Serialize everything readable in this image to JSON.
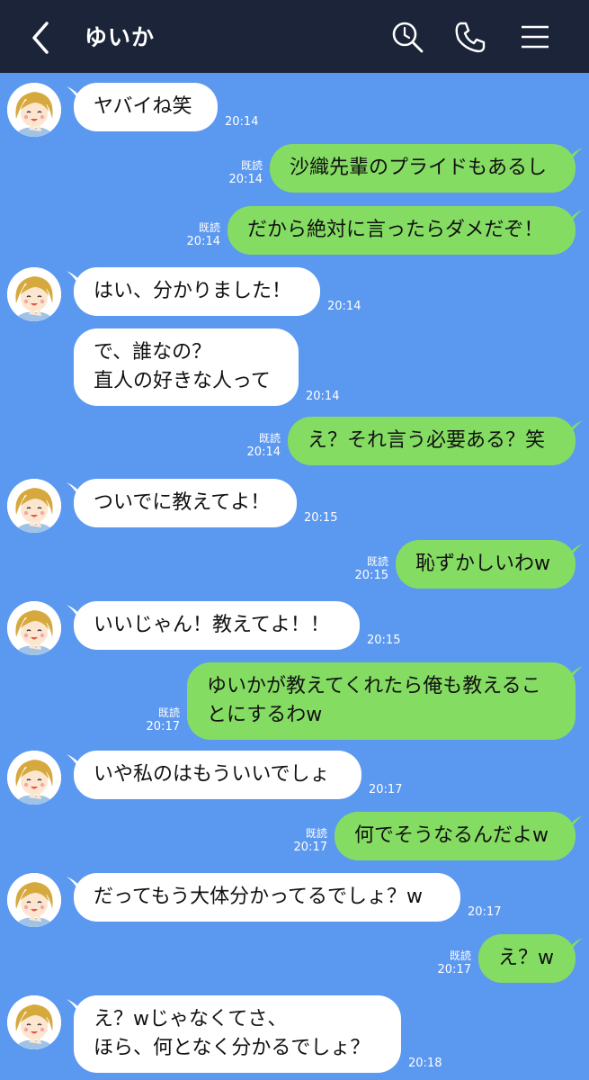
{
  "header": {
    "title": "ゆいか"
  },
  "read_label": "既読",
  "messages": [
    {
      "side": "in",
      "avatar": true,
      "text": "ヤバイね笑",
      "time": "20:14"
    },
    {
      "side": "out",
      "text": "沙織先輩のプライドもあるし",
      "time": "20:14"
    },
    {
      "side": "out",
      "text": "だから絶対に言ったらダメだぞ！",
      "time": "20:14"
    },
    {
      "side": "in",
      "avatar": true,
      "text": "はい、分かりました！",
      "time": "20:14"
    },
    {
      "side": "in",
      "avatar": false,
      "text": "で、誰なの？\n直人の好きな人って",
      "time": "20:14"
    },
    {
      "side": "out",
      "text": "え？それ言う必要ある？笑",
      "time": "20:14"
    },
    {
      "side": "in",
      "avatar": true,
      "text": "ついでに教えてよ！",
      "time": "20:15"
    },
    {
      "side": "out",
      "text": "恥ずかしいわw",
      "time": "20:15"
    },
    {
      "side": "in",
      "avatar": true,
      "text": "いいじゃん！教えてよ！！",
      "time": "20:15"
    },
    {
      "side": "out",
      "text": "ゆいかが教えてくれたら俺も教えるこ\nとにするわw",
      "time": "20:17"
    },
    {
      "side": "in",
      "avatar": true,
      "text": "いや私のはもういいでしょ",
      "time": "20:17"
    },
    {
      "side": "out",
      "text": "何でそうなるんだよw",
      "time": "20:17"
    },
    {
      "side": "in",
      "avatar": true,
      "text": "だってもう大体分かってるでしょ？w",
      "time": "20:17"
    },
    {
      "side": "out",
      "text": "え？w",
      "time": "20:17"
    },
    {
      "side": "in",
      "avatar": true,
      "text": "え？wじゃなくてさ、\nほら、何となく分かるでしょ？",
      "time": "20:18"
    }
  ],
  "colors": {
    "background": "#5b98f0",
    "header": "#1b2438",
    "bubble_out": "#85dc63",
    "bubble_in": "#ffffff"
  },
  "icons": [
    "back-arrow-icon",
    "search-icon",
    "phone-icon",
    "menu-icon",
    "avatar-icon"
  ]
}
